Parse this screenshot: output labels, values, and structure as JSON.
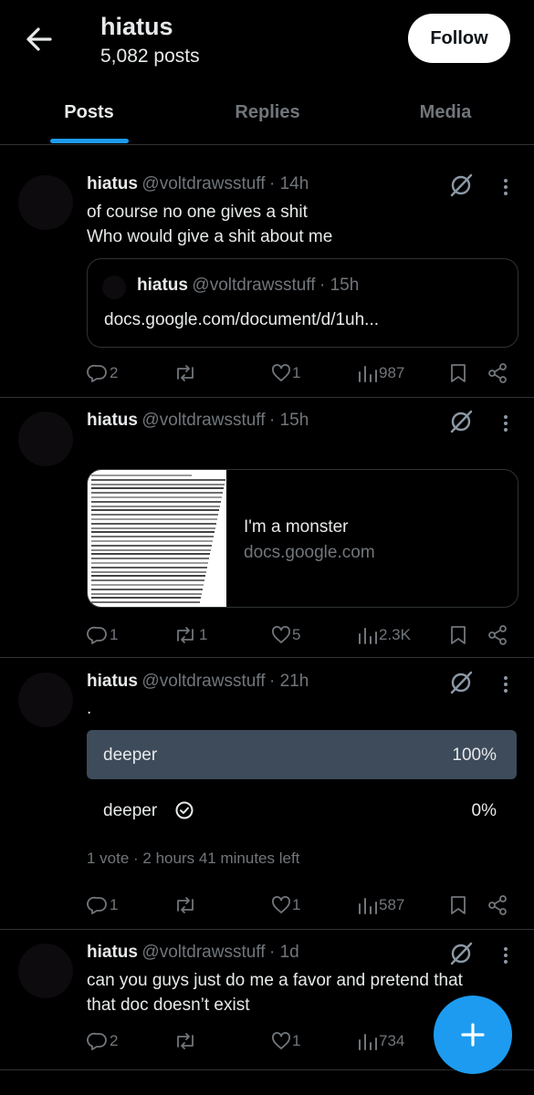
{
  "header": {
    "title": "hiatus",
    "subtitle": "5,082 posts",
    "follow_label": "Follow"
  },
  "tabs": [
    "Posts",
    "Replies",
    "Media"
  ],
  "posts": [
    {
      "name": "hiatus",
      "handle": "@voltdrawsstuff",
      "time": "· 14h",
      "text": "of course no one gives a shit\nWho would give a shit about me",
      "quote": {
        "name": "hiatus",
        "handle": "@voltdrawsstuff",
        "time": "· 15h",
        "text": "docs.google.com/document/d/1uh..."
      },
      "replies": "2",
      "reposts": "",
      "likes": "1",
      "views": "987"
    },
    {
      "name": "hiatus",
      "handle": "@voltdrawsstuff",
      "time": "· 15h",
      "card": {
        "title": "I'm a monster",
        "domain": "docs.google.com"
      },
      "replies": "1",
      "reposts": "1",
      "likes": "5",
      "views": "2.3K"
    },
    {
      "name": "hiatus",
      "handle": "@voltdrawsstuff",
      "time": "· 21h",
      "text": ".",
      "poll": {
        "options": [
          {
            "label": "deeper",
            "percent": "100%",
            "fraction": 1.0
          },
          {
            "label": "deeper",
            "percent": "0%",
            "fraction": 0.0
          }
        ],
        "meta": "1 vote · 2 hours 41 minutes left"
      },
      "replies": "1",
      "reposts": "",
      "likes": "1",
      "views": "587"
    },
    {
      "name": "hiatus",
      "handle": "@voltdrawsstuff",
      "time": "· 1d",
      "text": "can you guys just do me a favor and pretend that\nthat doc doesn’t exist",
      "replies": "2",
      "reposts": "",
      "likes": "1",
      "views": "734"
    }
  ],
  "colors": {
    "accent": "#1d9bf0",
    "background": "#000000",
    "muted": "#71767b",
    "divider": "#2f3336",
    "poll_bar": "#3d4b5a"
  },
  "icons": [
    "back-arrow-icon",
    "grok-icon",
    "more-icon",
    "reply-icon",
    "repost-icon",
    "like-icon",
    "views-icon",
    "bookmark-icon",
    "share-icon",
    "check-circle-icon",
    "plus-icon"
  ]
}
